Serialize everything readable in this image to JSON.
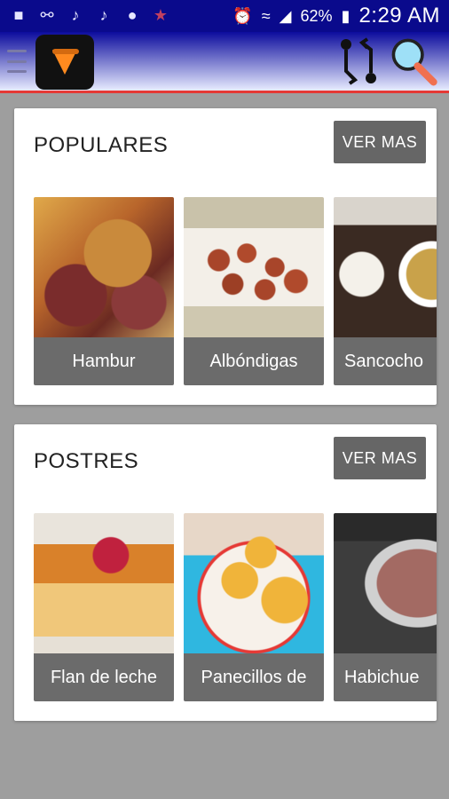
{
  "status_bar": {
    "battery": "62%",
    "time": "2:29 AM"
  },
  "sections": [
    {
      "title": "POPULARES",
      "button": "VER MAS",
      "items": [
        "Hambur",
        "Albóndigas",
        "Sancocho"
      ]
    },
    {
      "title": "POSTRES",
      "button": "VER MAS",
      "items": [
        "Flan de leche",
        "Panecillos de",
        "Habichue"
      ]
    }
  ],
  "colors": {
    "status_bar": "#0a0a8c",
    "accent_line": "#e53935",
    "tile_label_bg": "#6b6b6b",
    "button_bg": "#666666"
  }
}
